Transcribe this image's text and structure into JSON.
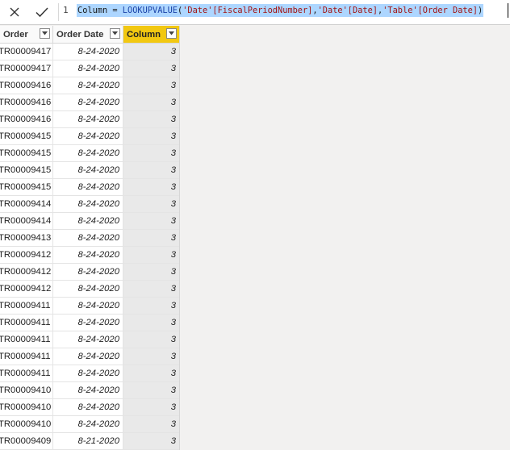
{
  "formula_bar": {
    "line_number": "1",
    "formula": [
      {
        "t": "Column = ",
        "k": "kw"
      },
      {
        "t": "LOOKUPVALUE",
        "k": "fn"
      },
      {
        "t": "(",
        "k": "kw"
      },
      {
        "t": "'Date'[FiscalPeriodNumber]",
        "k": "str"
      },
      {
        "t": ",",
        "k": "kw"
      },
      {
        "t": "'Date'[Date]",
        "k": "str"
      },
      {
        "t": ",",
        "k": "kw"
      },
      {
        "t": "'Table'[Order Date]",
        "k": "str"
      },
      {
        "t": ")",
        "k": "kw"
      }
    ],
    "cancel_icon": "close-icon",
    "commit_icon": "checkmark-icon"
  },
  "table": {
    "columns": [
      "Order",
      "Order Date",
      "Column"
    ],
    "selected_column": "Column",
    "accent_color": "#f2c811",
    "rows": [
      [
        "TR00009417",
        "8-24-2020",
        "3"
      ],
      [
        "TR00009417",
        "8-24-2020",
        "3"
      ],
      [
        "TR00009416",
        "8-24-2020",
        "3"
      ],
      [
        "TR00009416",
        "8-24-2020",
        "3"
      ],
      [
        "TR00009416",
        "8-24-2020",
        "3"
      ],
      [
        "TR00009415",
        "8-24-2020",
        "3"
      ],
      [
        "TR00009415",
        "8-24-2020",
        "3"
      ],
      [
        "TR00009415",
        "8-24-2020",
        "3"
      ],
      [
        "TR00009415",
        "8-24-2020",
        "3"
      ],
      [
        "TR00009414",
        "8-24-2020",
        "3"
      ],
      [
        "TR00009414",
        "8-24-2020",
        "3"
      ],
      [
        "TR00009413",
        "8-24-2020",
        "3"
      ],
      [
        "TR00009412",
        "8-24-2020",
        "3"
      ],
      [
        "TR00009412",
        "8-24-2020",
        "3"
      ],
      [
        "TR00009412",
        "8-24-2020",
        "3"
      ],
      [
        "TR00009411",
        "8-24-2020",
        "3"
      ],
      [
        "TR00009411",
        "8-24-2020",
        "3"
      ],
      [
        "TR00009411",
        "8-24-2020",
        "3"
      ],
      [
        "TR00009411",
        "8-24-2020",
        "3"
      ],
      [
        "TR00009411",
        "8-24-2020",
        "3"
      ],
      [
        "TR00009410",
        "8-24-2020",
        "3"
      ],
      [
        "TR00009410",
        "8-24-2020",
        "3"
      ],
      [
        "TR00009410",
        "8-24-2020",
        "3"
      ],
      [
        "TR00009409",
        "8-21-2020",
        "3"
      ]
    ]
  }
}
